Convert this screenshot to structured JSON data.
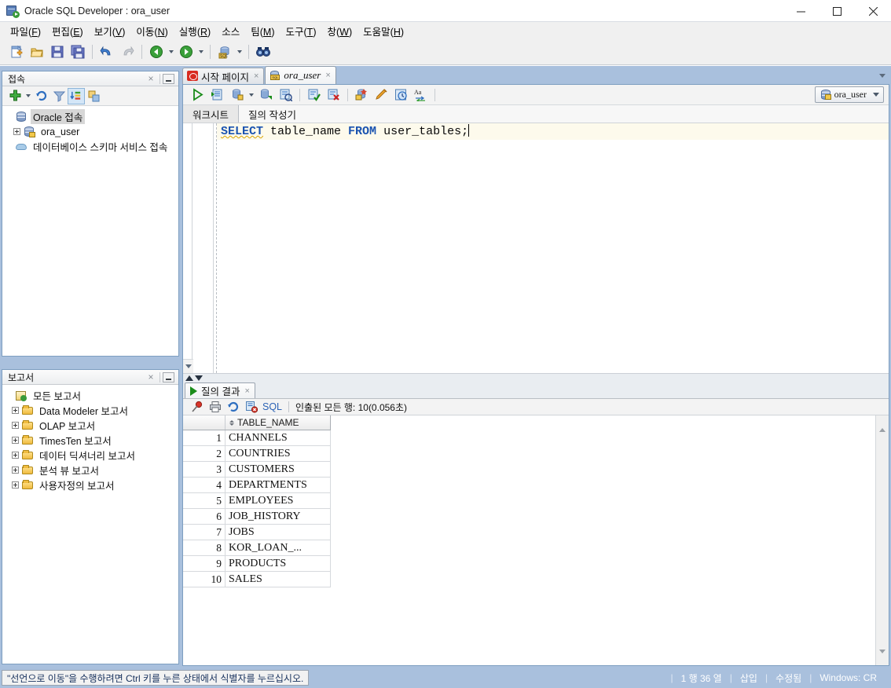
{
  "window": {
    "title": "Oracle SQL Developer : ora_user",
    "app_icon": "sqldeveloper-icon",
    "controls": {
      "minimize": "minimize-icon",
      "maximize": "maximize-icon",
      "close": "close-icon"
    }
  },
  "menubar": {
    "items": [
      {
        "label": "파일",
        "mnemonic": "F"
      },
      {
        "label": "편집",
        "mnemonic": "E"
      },
      {
        "label": "보기",
        "mnemonic": "V"
      },
      {
        "label": "이동",
        "mnemonic": "N"
      },
      {
        "label": "실행",
        "mnemonic": "R"
      },
      {
        "label": "소스",
        "mnemonic": ""
      },
      {
        "label": "팀",
        "mnemonic": "M"
      },
      {
        "label": "도구",
        "mnemonic": "T"
      },
      {
        "label": "창",
        "mnemonic": "W"
      },
      {
        "label": "도움말",
        "mnemonic": "H"
      }
    ]
  },
  "toolbar": {
    "buttons": [
      "new-file-icon",
      "open-file-icon",
      "save-icon",
      "save-all-icon",
      "undo-icon",
      "redo-icon",
      "navigate-back-icon",
      "navigate-forward-icon",
      "sql-worksheet-icon",
      "find-icon"
    ]
  },
  "connections_panel": {
    "title": "접속",
    "close": "close-icon",
    "minimize": "minimize-icon",
    "tools": [
      "new-connection-icon",
      "dropdown-caret-icon",
      "refresh-icon",
      "filter-icon",
      "sort-icon",
      "collapse-all-icon"
    ],
    "tree": [
      {
        "label": "Oracle 접속",
        "icon": "database-icon",
        "selected": true,
        "expandable": false
      },
      {
        "label": "ora_user",
        "icon": "connection-icon",
        "selected": false,
        "expandable": true
      },
      {
        "label": "데이터베이스 스키마 서비스 접속",
        "icon": "cloud-icon",
        "selected": false,
        "expandable": false
      }
    ]
  },
  "reports_panel": {
    "title": "보고서",
    "close": "close-icon",
    "minimize": "minimize-icon",
    "tree": [
      {
        "label": "모든 보고서",
        "icon": "reports-root-icon",
        "expandable": false
      },
      {
        "label": "Data Modeler 보고서",
        "icon": "folder-icon",
        "expandable": true
      },
      {
        "label": "OLAP 보고서",
        "icon": "folder-icon",
        "expandable": true
      },
      {
        "label": "TimesTen 보고서",
        "icon": "folder-icon",
        "expandable": true
      },
      {
        "label": "데이터 딕셔너리 보고서",
        "icon": "folder-icon",
        "expandable": true
      },
      {
        "label": "분석 뷰 보고서",
        "icon": "folder-icon",
        "expandable": true
      },
      {
        "label": "사용자정의 보고서",
        "icon": "folder-icon",
        "expandable": true
      }
    ]
  },
  "editor": {
    "tabs": [
      {
        "label": "시작 페이지",
        "icon": "oracle-logo-icon",
        "active": false,
        "close": "×"
      },
      {
        "label": "ora_user",
        "icon": "sql-worksheet-icon",
        "active": true,
        "close": "×"
      }
    ],
    "tab_overflow": "chevron-down-icon",
    "worksheet_toolbar": [
      "run-statement-icon",
      "run-script-icon",
      "explain-plan-icon",
      "explain-plan-caret-icon",
      "autotrace-icon",
      "sql-history-icon",
      "commit-icon",
      "rollback-icon",
      "compile-icon",
      "clear-icon",
      "schedule-icon",
      "format-icon"
    ],
    "connection_selector": {
      "label": "ora_user",
      "icon": "connection-icon",
      "caret": "chevron-down-icon"
    },
    "subtabs": [
      {
        "label": "워크시트",
        "active": true
      },
      {
        "label": "질의 작성기",
        "active": false
      }
    ],
    "sql": {
      "keyword1": "SELECT",
      "mid": " table_name ",
      "keyword2": "FROM",
      "tail": " user_tables;"
    }
  },
  "results": {
    "tab_label": "질의 결과",
    "tab_close": "×",
    "toolbar_icons": [
      "pin-icon",
      "print-icon",
      "refresh-icon",
      "clear-results-icon"
    ],
    "sql_label": "SQL",
    "status": "인출된 모든 행: 10(0.056초)",
    "columns": [
      "TABLE_NAME"
    ],
    "rows": [
      {
        "n": "1",
        "TABLE_NAME": "CHANNELS"
      },
      {
        "n": "2",
        "TABLE_NAME": "COUNTRIES"
      },
      {
        "n": "3",
        "TABLE_NAME": "CUSTOMERS"
      },
      {
        "n": "4",
        "TABLE_NAME": "DEPARTMENTS"
      },
      {
        "n": "5",
        "TABLE_NAME": "EMPLOYEES"
      },
      {
        "n": "6",
        "TABLE_NAME": "JOB_HISTORY"
      },
      {
        "n": "7",
        "TABLE_NAME": "JOBS"
      },
      {
        "n": "8",
        "TABLE_NAME": "KOR_LOAN_..."
      },
      {
        "n": "9",
        "TABLE_NAME": "PRODUCTS"
      },
      {
        "n": "10",
        "TABLE_NAME": "SALES"
      }
    ]
  },
  "statusbar": {
    "message": "\"선언으로 이동\"을 수행하려면 Ctrl 키를 누른 상태에서 식별자를 누르십시오.",
    "position": "1 행 36 열",
    "insert_mode": "삽입",
    "modified": "수정됨",
    "line_ending": "Windows: CR",
    "separator": "|"
  },
  "colors": {
    "desktop": "#a9c0dd",
    "keyword": "#1a53b0",
    "editor_bg": "#fdfaec",
    "accent_link": "#2b62b5",
    "squiggle": "#d9a400"
  }
}
